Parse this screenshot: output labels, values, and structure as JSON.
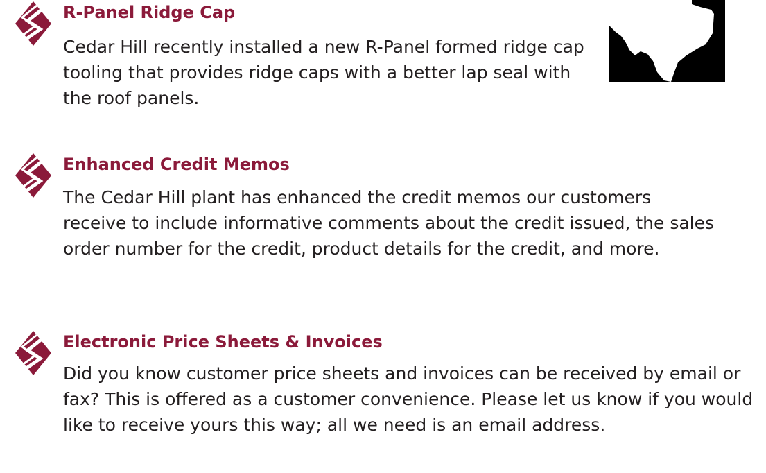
{
  "colors": {
    "heading": "#8b1a3a",
    "body_text": "#231f20",
    "logo": "#8b1a3a",
    "map_background": "#000000",
    "map_land": "#ffffff"
  },
  "icons": {
    "section_logo": "diamond-s-logo-icon",
    "map": "texas-map-icon"
  },
  "sections": [
    {
      "heading": "R-Panel Ridge Cap",
      "body": "Cedar Hill recently installed a new R-Panel formed ridge cap tooling that provides ridge caps with a better lap seal with the roof panels."
    },
    {
      "heading": "Enhanced Credit Memos",
      "body": "The Cedar Hill plant has enhanced the credit memos our customers receive to include informative comments about the credit issued, the sales order number for the credit, product details for the credit, and more."
    },
    {
      "heading": "Electronic Price Sheets & Invoices",
      "body": "Did you know customer price sheets and invoices can be received by email or fax? This is offered as a customer convenience. Please let us know if you would like to receive yours this way; all we need is an email address."
    }
  ]
}
